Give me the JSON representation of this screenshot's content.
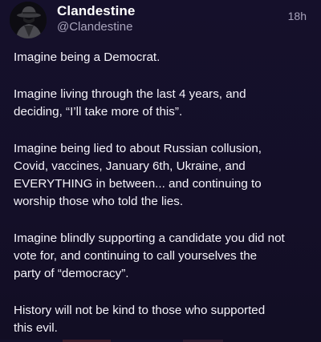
{
  "post": {
    "author_name": "Clandestine",
    "author_handle": "@Clandestine",
    "timestamp": "18h",
    "avatar_icon": "spy-avatar-icon",
    "paragraphs": [
      "Imagine being a Democrat.",
      "Imagine living through the last 4 years, and\ndeciding, “I’ll take more of this”.",
      "Imagine being lied to about Russian collusion,\nCovid, vaccines, January 6th, Ukraine, and\nEVERYTHING in between... and continuing to\nworship those who told the lies.",
      "Imagine blindly supporting a candidate you did not\nvote for, and continuing to call yourselves the\nparty of “democracy”.",
      "History will not be kind to those who supported\nthis evil."
    ]
  },
  "colors": {
    "background": "#14102a",
    "text": "#f4f2f9",
    "muted": "#a9a4bc"
  }
}
